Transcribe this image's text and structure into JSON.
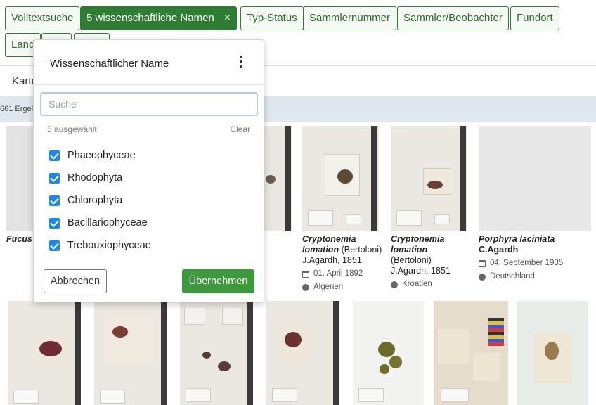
{
  "filters": [
    {
      "label": "Volltextsuche",
      "active": false
    },
    {
      "label": "5 wissenschaftliche Namen",
      "active": true
    },
    {
      "label": "Typ-Status",
      "active": false
    },
    {
      "label": "Sammlernummer",
      "active": false
    },
    {
      "label": "Sammler/Beobachter",
      "active": false
    },
    {
      "label": "Fundort",
      "active": false
    },
    {
      "label": "Land",
      "active": false
    },
    {
      "label": "",
      "active": false
    },
    {
      "label": "",
      "active": false
    }
  ],
  "active_close_glyph": "×",
  "view_tab": "Karte",
  "result_count": "661 Ergel",
  "popup": {
    "title": "Wissenschaftlicher Name",
    "menu_icon": "kebab-vertical-icon",
    "search_placeholder": "Suche",
    "selected_count": "5 ausgewählt",
    "clear_label": "Clear",
    "options": [
      {
        "label": "Phaeophyceae",
        "checked": true
      },
      {
        "label": "Rhodophyta",
        "checked": true
      },
      {
        "label": "Chlorophyta",
        "checked": true
      },
      {
        "label": "Bacillariophyceae",
        "checked": true
      },
      {
        "label": "Trebouxiophyceae",
        "checked": true
      }
    ],
    "cancel_label": "Abbrechen",
    "apply_label": "Übernehmen"
  },
  "cards_row1": [
    {
      "name_italic": "Fucus c",
      "author": "",
      "date": "",
      "country": ""
    },
    {
      "name_italic": "",
      "author": "",
      "date": "",
      "country": ""
    },
    {
      "name_italic": "",
      "author": "",
      "date": "",
      "country": ""
    },
    {
      "name_italic": "Cryptonemia lomation",
      "author": "(Bertoloni) J.Agardh, 1851",
      "date": "01. April 1892",
      "country": "Algerien"
    },
    {
      "name_italic": "Cryptonemia lomation",
      "author": "(Bertoloni) J.Agardh, 1851",
      "date": "",
      "country": "Kroatien"
    },
    {
      "name_italic": "Porphyra laciniata",
      "author": "C.Agardh",
      "date": "04. September 1935",
      "country": "Deutschland"
    }
  ],
  "colors": {
    "accent_green": "#2e7d32",
    "checkbox_blue": "#1e88e5",
    "apply_green": "#3c9a3c"
  }
}
